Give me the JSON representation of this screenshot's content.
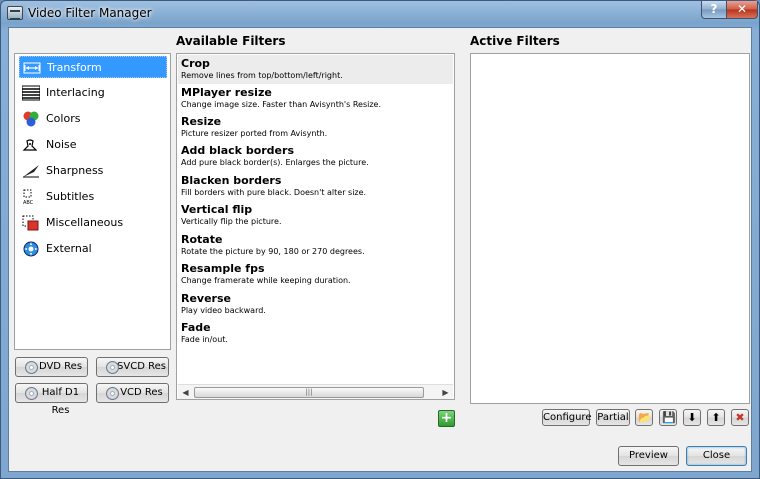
{
  "window": {
    "title": "Video Filter Manager",
    "help_glyph": "?",
    "close_glyph": "✕"
  },
  "headings": {
    "available": "Available Filters",
    "active": "Active Filters"
  },
  "categories": [
    {
      "label": "Transform",
      "icon": "transform-icon",
      "selected": true
    },
    {
      "label": "Interlacing",
      "icon": "interlacing-icon"
    },
    {
      "label": "Colors",
      "icon": "colors-icon"
    },
    {
      "label": "Noise",
      "icon": "noise-icon"
    },
    {
      "label": "Sharpness",
      "icon": "sharpness-icon"
    },
    {
      "label": "Subtitles",
      "icon": "subtitles-icon"
    },
    {
      "label": "Miscellaneous",
      "icon": "miscellaneous-icon"
    },
    {
      "label": "External",
      "icon": "external-icon"
    }
  ],
  "filters": [
    {
      "name": "Crop",
      "desc": "Remove lines from top/bottom/left/right."
    },
    {
      "name": "MPlayer resize",
      "desc": "Change image size. Faster than Avisynth's Resize."
    },
    {
      "name": "Resize",
      "desc": "Picture resizer ported from Avisynth."
    },
    {
      "name": "Add black borders",
      "desc": "Add pure black border(s). Enlarges the picture."
    },
    {
      "name": "Blacken borders",
      "desc": "Fill borders with pure black. Doesn't alter size."
    },
    {
      "name": "Vertical flip",
      "desc": "Vertically flip the picture."
    },
    {
      "name": "Rotate",
      "desc": "Rotate the picture by 90, 180 or 270 degrees."
    },
    {
      "name": "Resample fps",
      "desc": "Change framerate while keeping duration."
    },
    {
      "name": "Reverse",
      "desc": "Play video backward."
    },
    {
      "name": "Fade",
      "desc": "Fade in/out."
    }
  ],
  "scroll": {
    "left": "◀",
    "right": "▶",
    "grip": "|||"
  },
  "res_buttons": {
    "dvd": "DVD Res",
    "svcd": "SVCD Res",
    "half_d1": "Half D1 Res",
    "vcd": "VCD Res"
  },
  "actions": {
    "add": "+",
    "configure": "Configure",
    "partial": "Partial",
    "open": "📂",
    "save": "💾",
    "down": "⬇",
    "up": "⬆",
    "remove": "✖"
  },
  "footer": {
    "preview": "Preview",
    "close": "Close"
  },
  "colors": {
    "selection": "#3399ff",
    "title_bar": "#8eb3d9",
    "add_button": "#2f9b2f",
    "remove_button": "#c0392b"
  }
}
